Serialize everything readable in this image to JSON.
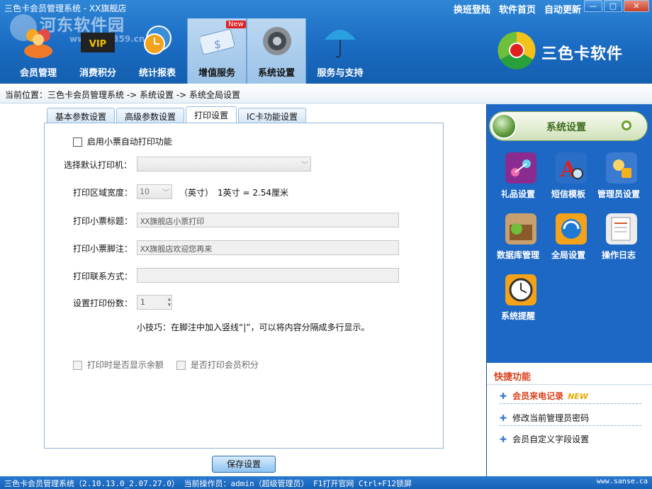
{
  "window": {
    "title": "三色卡会员管理系统 - XX旗舰店",
    "top_links": [
      "换班登陆",
      "软件首页",
      "自动更新"
    ],
    "controls": [
      "—",
      "□",
      "✕"
    ]
  },
  "watermark": {
    "main": "河东软件园",
    "sub": "www.pc0359.cn"
  },
  "nav": [
    {
      "label": "会员管理",
      "icon": "members-icon"
    },
    {
      "label": "消费积分",
      "icon": "vip-icon"
    },
    {
      "label": "统计报表",
      "icon": "clock-report-icon"
    },
    {
      "label": "增值服务",
      "icon": "value-service-icon",
      "badge": "New"
    },
    {
      "label": "系统设置",
      "icon": "gear-icon"
    },
    {
      "label": "服务与支持",
      "icon": "umbrella-icon"
    }
  ],
  "brand": {
    "text": "三色卡软件"
  },
  "breadcrumb": "当前位置：三色卡会员管理系统 -> 系统设置 -> 系统全局设置",
  "tabs": [
    "基本参数设置",
    "高级参数设置",
    "打印设置",
    "IC卡功能设置"
  ],
  "print": {
    "enable_label": "启用小票自动打印功能",
    "printer_label": "选择默认打印机：",
    "printer_value": "",
    "width_label": "打印区域宽度：",
    "width_value": "10",
    "width_unit": "（英寸）",
    "width_note": "1英寸 = 2.54厘米",
    "title_label": "打印小票标题：",
    "title_value": "XX旗舰店小票打印",
    "footer_label": "打印小票脚注：",
    "footer_value": "XX旗舰店欢迎您再来",
    "contact_label": "打印联系方式：",
    "contact_value": "",
    "copies_label": "设置打印份数：",
    "copies_value": "1",
    "tip": "小技巧：在脚注中加入竖线“|”，可以将内容分隔成多行显示。",
    "show_balance_label": "打印时是否显示余额",
    "show_points_label": "是否打印会员积分",
    "save_label": "保存设置"
  },
  "sidebar": {
    "title": "系统设置",
    "tools": [
      {
        "label": "礼品设置",
        "icon": "gift-icon",
        "color": "#8a2b8f"
      },
      {
        "label": "短信模板",
        "icon": "sms-template-icon",
        "color": "#c8202a"
      },
      {
        "label": "管理员设置",
        "icon": "admin-icon",
        "color": "#3a7ad0"
      },
      {
        "label": "数据库管理",
        "icon": "database-icon",
        "color": "#b3875a"
      },
      {
        "label": "全局设置",
        "icon": "global-settings-icon",
        "color": "#1f7ad6"
      },
      {
        "label": "操作日志",
        "icon": "log-icon",
        "color": "#d25a2a"
      },
      {
        "label": "系统提醒",
        "icon": "reminder-clock-icon",
        "color": "#e8a800"
      }
    ],
    "quick_title": "快捷功能",
    "quick": [
      {
        "label": "会员来电记录",
        "tag": "NEW"
      },
      {
        "label": "修改当前管理员密码"
      },
      {
        "label": "会员自定义字段设置"
      }
    ]
  },
  "status": {
    "left": "三色卡会员管理系统（2.10.13.0_2.07.27.0） 当前操作员：admin（超级管理员） F1打开官网 Ctrl+F12锁屏",
    "right": "www.sanse.ca"
  }
}
